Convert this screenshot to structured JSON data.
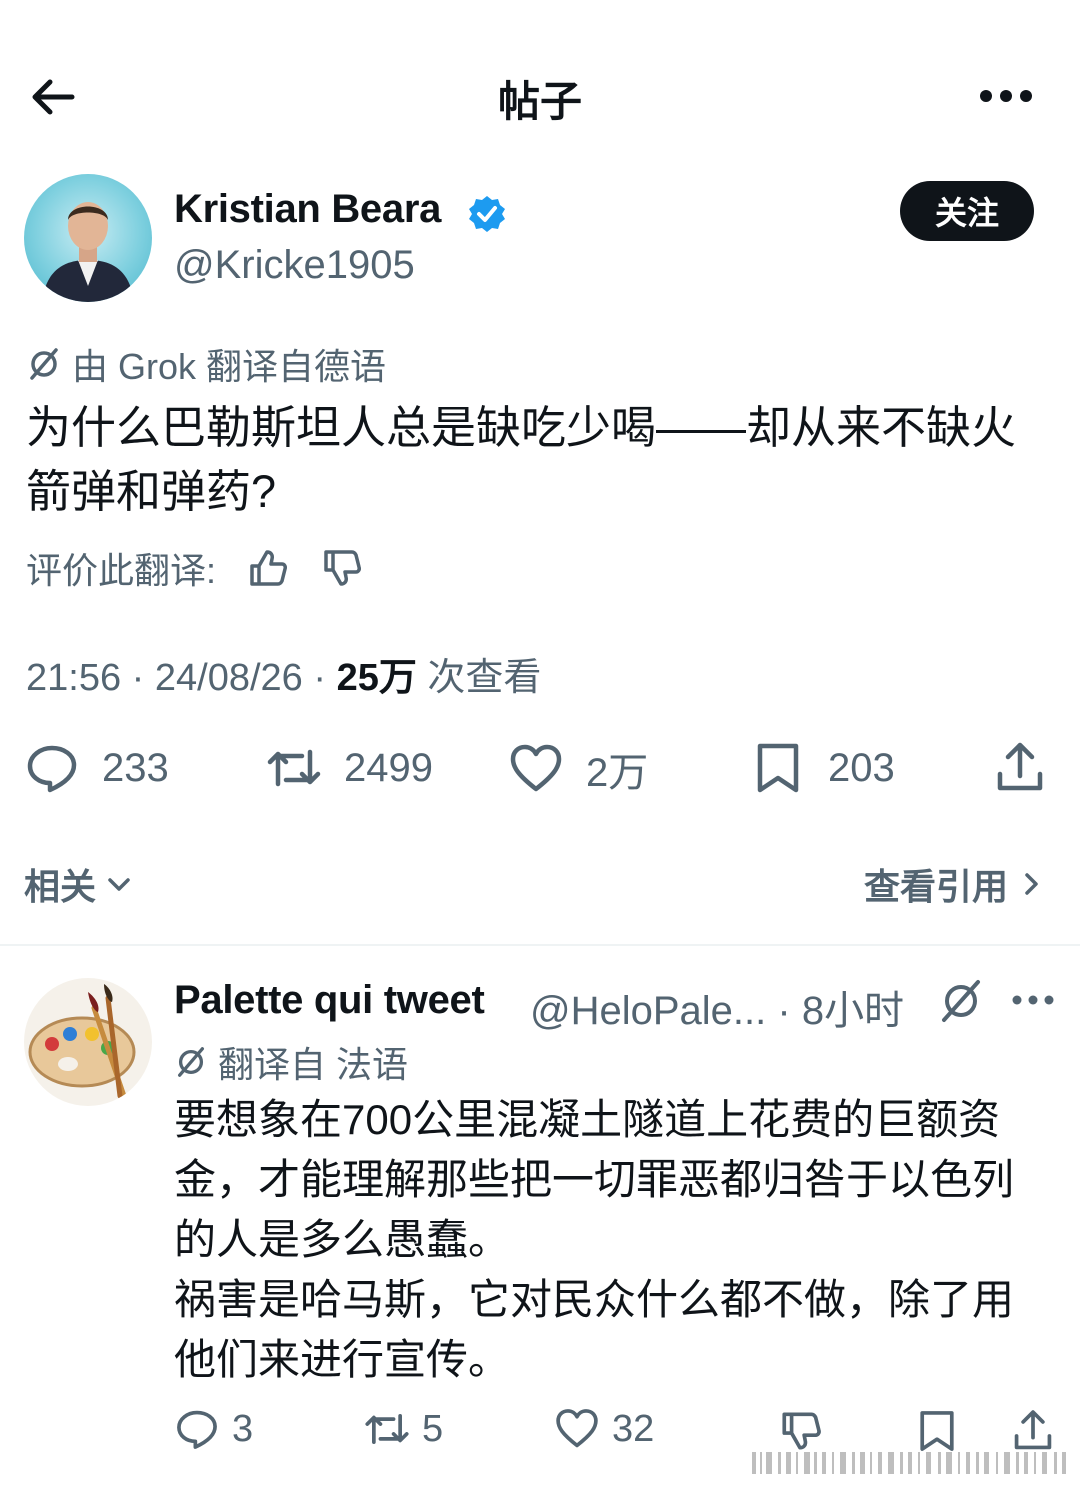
{
  "header": {
    "title": "帖子",
    "back_icon": "arrow-left-icon",
    "more_icon": "more-horizontal-icon"
  },
  "post": {
    "author_name": "Kristian Beara",
    "author_handle": "@Kricke1905",
    "follow_label": "关注",
    "translated_label": "由 Grok 翻译自德语",
    "text": "为什么巴勒斯坦人总是缺吃少喝——却从来不缺火箭弹和弹药?",
    "rate_label": "评价此翻译:",
    "time": "21:56",
    "date": "24/08/26",
    "views_count": "25万",
    "views_label": "次查看",
    "accent_color": "#1d9bf0"
  },
  "actions": {
    "replies": "233",
    "reposts": "2499",
    "likes": "2万",
    "bookmarks": "203"
  },
  "related": {
    "label": "相关",
    "quotes_label": "查看引用"
  },
  "reply": {
    "author_name": "Palette qui tweet",
    "handle_time": "@HeloPale... · 8小时",
    "translated_label": "翻译自 法语",
    "paragraph1": "要想象在700公里混凝土隧道上花费的巨额资金，才能理解那些把一切罪恶都归咎于以色列的人是多么愚蠢。",
    "paragraph2": "祸害是哈马斯，它对民众什么都不做，除了用他们来进行宣传。",
    "replies": "3",
    "reposts": "5",
    "likes": "32"
  }
}
